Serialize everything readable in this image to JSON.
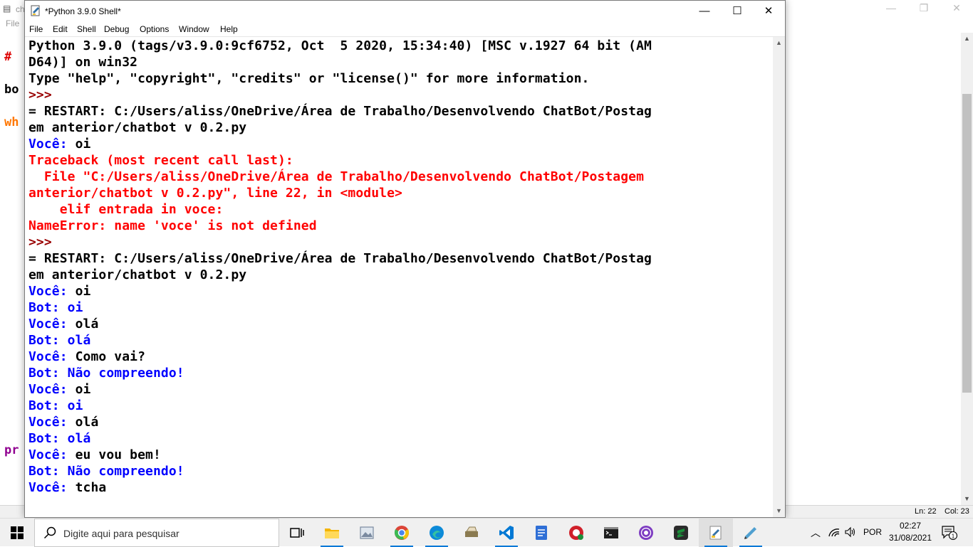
{
  "background_window": {
    "title": "ch",
    "menu_file": "File",
    "code_fragments": [
      {
        "text": "# ",
        "color": "#dd0000"
      },
      {
        "text": "bo",
        "color": "#000000"
      },
      {
        "text": "wh",
        "color": "#ff7700"
      },
      {
        "text": "pr",
        "color": "#900090"
      }
    ],
    "status": {
      "line": "Ln: 22",
      "col": "Col: 23"
    }
  },
  "shell": {
    "title": "*Python 3.9.0 Shell*",
    "menu": [
      "File",
      "Edit",
      "Shell",
      "Debug",
      "Options",
      "Window",
      "Help"
    ],
    "lines": [
      [
        {
          "t": "Python 3.9.0 (tags/v3.9.0:9cf6752, Oct  5 2020, 15:34:40) [MSC v.1927 64 bit (AM",
          "c": "black"
        }
      ],
      [
        {
          "t": "D64)] on win32",
          "c": "black"
        }
      ],
      [
        {
          "t": "Type \"help\", \"copyright\", \"credits\" or \"license()\" for more information.",
          "c": "black"
        }
      ],
      [
        {
          "t": ">>> ",
          "c": "maroon"
        }
      ],
      [
        {
          "t": "= RESTART: C:/Users/aliss/OneDrive/Área de Trabalho/Desenvolvendo ChatBot/Postag",
          "c": "black"
        }
      ],
      [
        {
          "t": "em anterior/chatbot v 0.2.py",
          "c": "black"
        }
      ],
      [
        {
          "t": "Você: ",
          "c": "blue"
        },
        {
          "t": "oi",
          "c": "black"
        }
      ],
      [
        {
          "t": "Traceback (most recent call last):",
          "c": "red"
        }
      ],
      [
        {
          "t": "  File \"C:/Users/aliss/OneDrive/Área de Trabalho/Desenvolvendo ChatBot/Postagem",
          "c": "red"
        }
      ],
      [
        {
          "t": "anterior/chatbot v 0.2.py\", line 22, in <module>",
          "c": "red"
        }
      ],
      [
        {
          "t": "    elif entrada in voce:",
          "c": "red"
        }
      ],
      [
        {
          "t": "NameError: name 'voce' is not defined",
          "c": "red"
        }
      ],
      [
        {
          "t": ">>> ",
          "c": "maroon"
        }
      ],
      [
        {
          "t": "= RESTART: C:/Users/aliss/OneDrive/Área de Trabalho/Desenvolvendo ChatBot/Postag",
          "c": "black"
        }
      ],
      [
        {
          "t": "em anterior/chatbot v 0.2.py",
          "c": "black"
        }
      ],
      [
        {
          "t": "Você: ",
          "c": "blue"
        },
        {
          "t": "oi",
          "c": "black"
        }
      ],
      [
        {
          "t": "Bot: oi",
          "c": "blue"
        }
      ],
      [
        {
          "t": "Você: ",
          "c": "blue"
        },
        {
          "t": "olá",
          "c": "black"
        }
      ],
      [
        {
          "t": "Bot: olá",
          "c": "blue"
        }
      ],
      [
        {
          "t": "Você: ",
          "c": "blue"
        },
        {
          "t": "Como vai?",
          "c": "black"
        }
      ],
      [
        {
          "t": "Bot: Não compreendo!",
          "c": "blue"
        }
      ],
      [
        {
          "t": "Você: ",
          "c": "blue"
        },
        {
          "t": "oi",
          "c": "black"
        }
      ],
      [
        {
          "t": "Bot: oi",
          "c": "blue"
        }
      ],
      [
        {
          "t": "Você: ",
          "c": "blue"
        },
        {
          "t": "olá",
          "c": "black"
        }
      ],
      [
        {
          "t": "Bot: olá",
          "c": "blue"
        }
      ],
      [
        {
          "t": "Você: ",
          "c": "blue"
        },
        {
          "t": "eu vou bem!",
          "c": "black"
        }
      ],
      [
        {
          "t": "Bot: Não compreendo!",
          "c": "blue"
        }
      ],
      [
        {
          "t": "Você: ",
          "c": "blue"
        },
        {
          "t": "tcha",
          "c": "black"
        }
      ]
    ]
  },
  "taskbar": {
    "search_placeholder": "Digite aqui para pesquisar",
    "apps": [
      {
        "name": "task-view-icon",
        "color": "#000000"
      },
      {
        "name": "file-explorer-icon",
        "color": "#f4b400"
      },
      {
        "name": "photos-app-icon",
        "color": "#7a8aa0"
      },
      {
        "name": "chrome-icon",
        "color": "#db4437"
      },
      {
        "name": "edge-icon",
        "color": "#0c8ad8"
      },
      {
        "name": "scanner-app-icon",
        "color": "#8a7a50"
      },
      {
        "name": "vscode-icon",
        "color": "#0078d4"
      },
      {
        "name": "docs-app-icon",
        "color": "#2f6fd6"
      },
      {
        "name": "recorder-app-icon",
        "color": "#d0202a"
      },
      {
        "name": "terminal-icon",
        "color": "#1e1e1e"
      },
      {
        "name": "tor-browser-icon",
        "color": "#7d3bc1"
      },
      {
        "name": "sublime-text-icon",
        "color": "#1b8f3a"
      },
      {
        "name": "python-idle-icon",
        "color": "#3572a5"
      },
      {
        "name": "notepad-app-icon",
        "color": "#50a0d0"
      }
    ],
    "tray": {
      "language": "POR",
      "time": "02:27",
      "date": "31/08/2021",
      "notification_count": "1"
    }
  }
}
